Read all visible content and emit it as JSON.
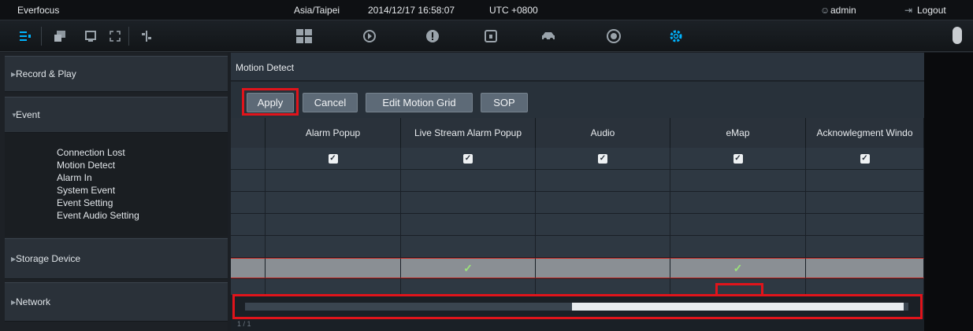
{
  "topbar": {
    "app_name": "Everfocus",
    "timezone": "Asia/Taipei",
    "datetime": "2014/12/17 16:58:07",
    "utc": "UTC +0800",
    "user": "admin",
    "logout": "Logout",
    "user_icon": "user-icon",
    "logout_icon": "logout-icon"
  },
  "toolbar": {
    "icons": [
      "list-icon",
      "multi-window-icon",
      "monitor-icon",
      "fullscreen-icon",
      "split-icon",
      "layout-grid-icon",
      "playback-icon",
      "alert-icon",
      "lock-icon",
      "car-icon",
      "face-icon",
      "settings-icon"
    ]
  },
  "sidebar": {
    "record_play": "Record & Play",
    "event": "Event",
    "event_items": [
      "Connection Lost",
      "Motion Detect",
      "Alarm In",
      "System Event",
      "Event Setting",
      "Event Audio Setting"
    ],
    "storage": "Storage Device",
    "network": "Network"
  },
  "main": {
    "title": "Motion Detect",
    "buttons": {
      "apply": "Apply",
      "cancel": "Cancel",
      "edit_grid": "Edit Motion Grid",
      "sop": "SOP"
    },
    "columns": [
      "Alarm Popup",
      "Live Stream Alarm Popup",
      "Audio",
      "eMap",
      "Acknowlegment Windo"
    ],
    "row_checkboxes": [
      true,
      true,
      true,
      true,
      true
    ],
    "selected_row_ticks": [
      false,
      true,
      false,
      true,
      false
    ],
    "pager": "1 / 1",
    "scroll_position": 0.5
  },
  "colors": {
    "highlight": "#e0141b",
    "tick": "#9be37a",
    "accent": "#00b4ff"
  }
}
